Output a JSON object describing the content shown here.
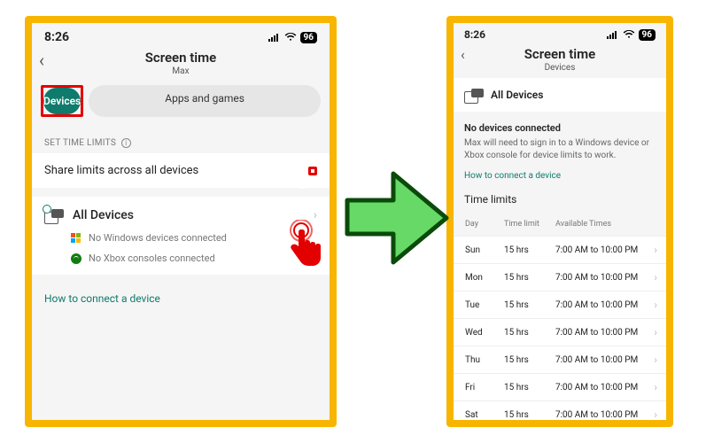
{
  "status": {
    "time": "8:26",
    "battery": "96"
  },
  "screen1": {
    "title": "Screen time",
    "subtitle": "Max",
    "tabs": {
      "devices": "Devices",
      "apps": "Apps and games"
    },
    "section_label": "SET TIME LIMITS",
    "share_label": "Share limits across all devices",
    "all_devices": "All Devices",
    "no_windows": "No Windows devices connected",
    "no_xbox": "No Xbox consoles connected",
    "howto": "How to connect a device"
  },
  "screen2": {
    "title": "Screen time",
    "subtitle": "Devices",
    "all_devices": "All Devices",
    "no_devices_title": "No devices connected",
    "no_devices_body": "Max will need to sign in to a Windows device or Xbox console for device limits to work.",
    "howto": "How to connect a device",
    "time_limits_title": "Time limits",
    "cols": {
      "day": "Day",
      "limit": "Time limit",
      "avail": "Available Times"
    },
    "rows": [
      {
        "day": "Sun",
        "limit": "15 hrs",
        "avail": "7:00 AM to 10:00 PM"
      },
      {
        "day": "Mon",
        "limit": "15 hrs",
        "avail": "7:00 AM to 10:00 PM"
      },
      {
        "day": "Tue",
        "limit": "15 hrs",
        "avail": "7:00 AM to 10:00 PM"
      },
      {
        "day": "Wed",
        "limit": "15 hrs",
        "avail": "7:00 AM to 10:00 PM"
      },
      {
        "day": "Thu",
        "limit": "15 hrs",
        "avail": "7:00 AM to 10:00 PM"
      },
      {
        "day": "Fri",
        "limit": "15 hrs",
        "avail": "7:00 AM to 10:00 PM"
      },
      {
        "day": "Sat",
        "limit": "15 hrs",
        "avail": "7:00 AM to 10:00 PM"
      }
    ]
  }
}
